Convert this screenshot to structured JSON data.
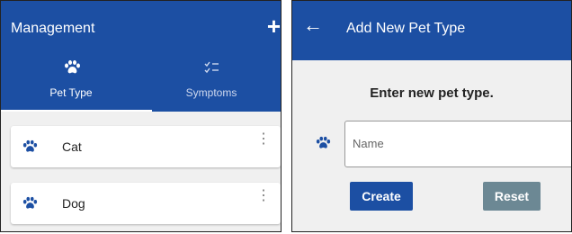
{
  "left": {
    "title": "Management",
    "add_icon": "plus-icon",
    "tabs": [
      {
        "label": "Pet Type",
        "icon": "paw-icon",
        "active": true
      },
      {
        "label": "Symptoms",
        "icon": "checklist-icon",
        "active": false
      }
    ],
    "pets": [
      {
        "name": "Cat",
        "icon": "paw-icon"
      },
      {
        "name": "Dog",
        "icon": "paw-icon"
      }
    ]
  },
  "right": {
    "title": "Add New Pet Type",
    "back_icon": "back-arrow-icon",
    "prompt": "Enter new pet type.",
    "input_placeholder": "Name",
    "create_label": "Create",
    "reset_label": "Reset"
  },
  "colors": {
    "primary": "#1c4fa3",
    "reset": "#6c8894"
  }
}
